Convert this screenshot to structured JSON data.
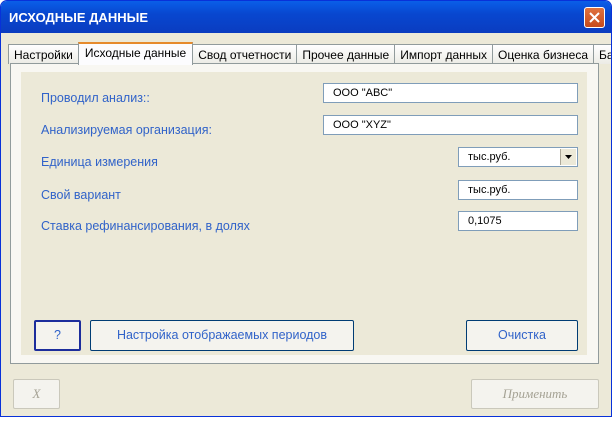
{
  "window": {
    "title": "ИСХОДНЫЕ ДАННЫЕ"
  },
  "tabs": [
    {
      "label": "Настройки"
    },
    {
      "label": "Исходные данные"
    },
    {
      "label": "Свод отчетности"
    },
    {
      "label": "Прочее данные"
    },
    {
      "label": "Импорт данных"
    },
    {
      "label": "Оценка бизнеса"
    },
    {
      "label": "Банк"
    }
  ],
  "active_tab": "Исходные данные",
  "form": {
    "analyst_label": "Проводил анализ::",
    "analyst_value": "ООО \"ABC\"",
    "org_label": "Анализируемая организация:",
    "org_value": "ООО \"XYZ\"",
    "unit_label": "Единица измерения",
    "unit_value": "тыс.руб.",
    "custom_label": "Свой вариант",
    "custom_value": "тыс.руб.",
    "rate_label": "Ставка рефинансирования, в долях",
    "rate_value": "0,1075"
  },
  "buttons": {
    "help": "?",
    "periods": "Настройка отображаемых периодов",
    "clear": "Очистка",
    "close_x": "X",
    "apply": "Применить"
  },
  "icons": {
    "close": "close-icon",
    "dropdown": "chevron-down-icon"
  }
}
